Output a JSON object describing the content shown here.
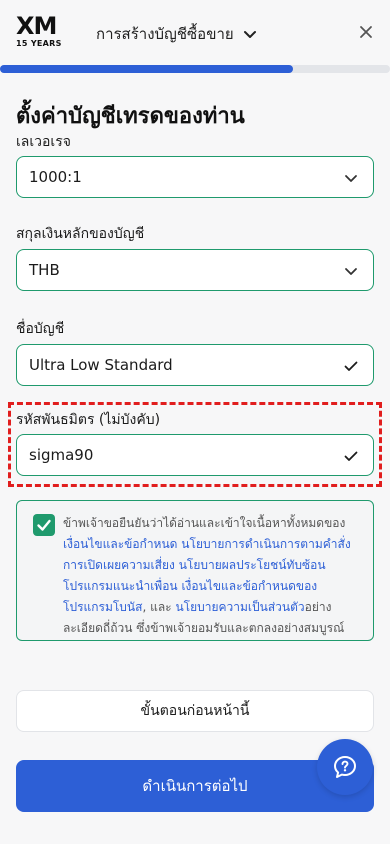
{
  "header": {
    "logo_text": "XM",
    "logo_subtext": "15 YEARS",
    "title": "การสร้างบัญชีซื้อขาย"
  },
  "progress": {
    "fraction": 0.75
  },
  "page": {
    "title": "ตั้งค่าบัญชีเทรดของท่าน"
  },
  "form": {
    "leverage": {
      "label": "เลเวอเรจ",
      "value": "1000:1"
    },
    "currency": {
      "label": "สกุลเงินหลักของบัญชี",
      "value": "THB"
    },
    "account_name": {
      "label": "ชื่อบัญชี",
      "value": "Ultra Low Standard"
    },
    "referral": {
      "label": "รหัสพันธมิตร (ไม่บังคับ)",
      "value": "sigma90"
    }
  },
  "agreement": {
    "t1": "ข้าพเจ้าขอยืนยันว่าได้อ่านและเข้าใจเนื้อหาทั้งหมด",
    "t2": "ของ",
    "link1": "เงื่อนไขและข้อกำหนด",
    "t3": " ",
    "link2": "นโยบายการดำเนินการตามคำสั่ง",
    "t4": " ",
    "link3": "การเปิดเผยความเสี่ยง",
    "t5": " ",
    "link4": "นโยบายผลประโยชน์ทับซ้อน",
    "t6": " ",
    "link5": "โปรแกรมแนะนำเพื่อน",
    "t7": " ",
    "link6": "เงื่อนไขและข้อกำหนดของโปรแกรมโบนัส",
    "t8": ", และ ",
    "link7": "นโยบายความเป็นส่วนตัว",
    "t9": "อย่างละเอียดถี่ถ้วน ซึ่งข้าพเจ้ายอมรับและตกลงอย่างสมบูรณ์"
  },
  "buttons": {
    "back": "ขั้นตอนก่อนหน้านี้",
    "next": "ดำเนินการต่อไป"
  },
  "colors": {
    "primary": "#2d5fd6",
    "valid_green": "#1f9a6d",
    "highlight_red": "#e11e1e"
  }
}
